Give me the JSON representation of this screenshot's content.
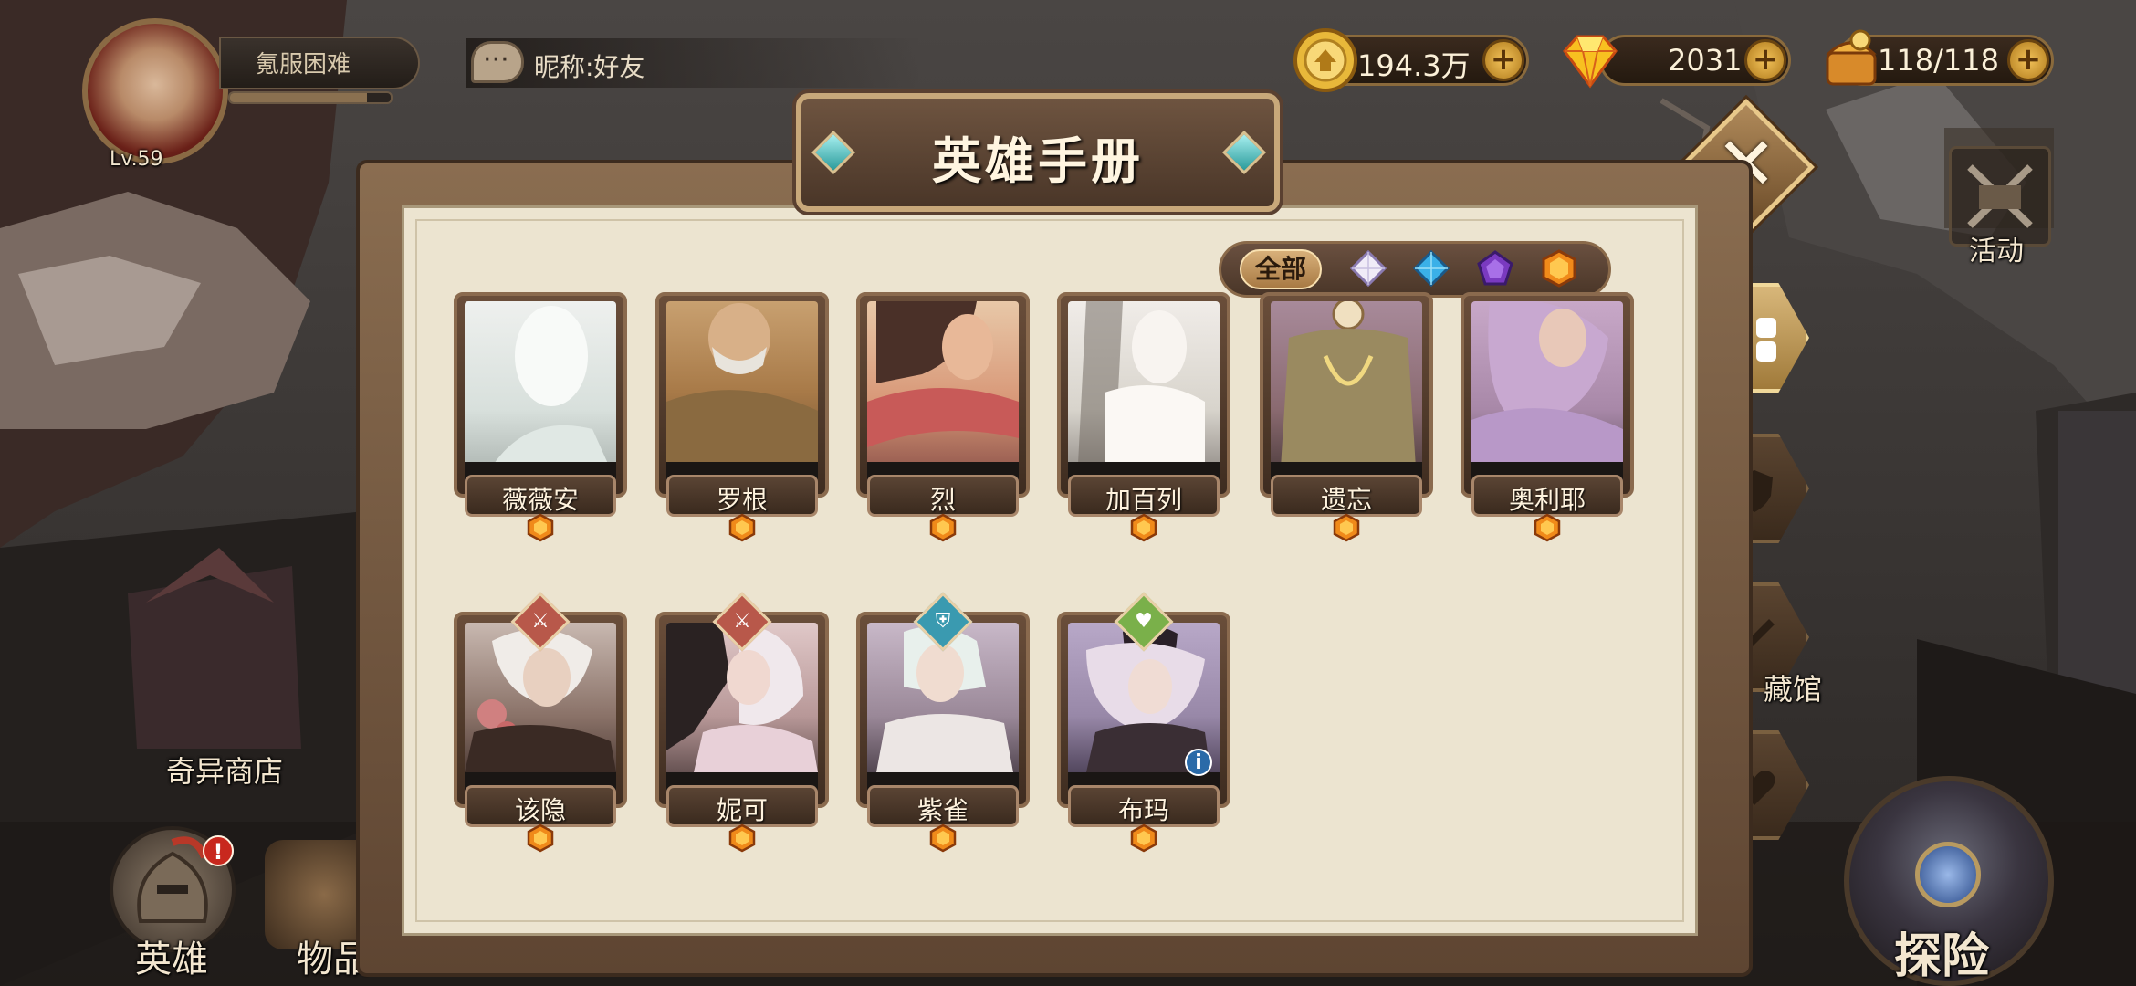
{
  "player": {
    "level": "Lv.59",
    "rank": "氪服困难",
    "rank_progress": 0.85
  },
  "chat": {
    "text": "昵称:好友"
  },
  "currency": {
    "gold": "194.3万",
    "gems": "2031",
    "stamina": "118/118"
  },
  "panel": {
    "title": "英雄手册"
  },
  "filters": {
    "all_label": "全部",
    "rarities": [
      "white-diamond-icon",
      "cyan-diamond-icon",
      "purple-pentagon-icon",
      "orange-hexagon-icon"
    ]
  },
  "heroes_row1": [
    {
      "name": "薇薇安"
    },
    {
      "name": "罗根"
    },
    {
      "name": "烈"
    },
    {
      "name": "加百列"
    },
    {
      "name": "遗忘"
    },
    {
      "name": "奥利耶"
    }
  ],
  "heroes_row2": [
    {
      "name": "该隐",
      "class_icon": "sword-icon",
      "class_color": "#b8584a"
    },
    {
      "name": "妮可",
      "class_icon": "sword-icon",
      "class_color": "#b8584a"
    },
    {
      "name": "紫雀",
      "class_icon": "shield-icon",
      "class_color": "#3a9ab0"
    },
    {
      "name": "布玛",
      "class_icon": "heart-icon",
      "class_color": "#7ab04a"
    }
  ],
  "side": {
    "activity": "活动",
    "museum": "藏馆"
  },
  "bottom": {
    "shop": "奇异商店",
    "hero": "英雄",
    "items": "物品",
    "explore": "探险",
    "hero_badge": "!"
  },
  "colors": {
    "panel_bg": "#ece4d0",
    "frame": "#6a4e3a",
    "accent_gold": "#d8b07a"
  }
}
